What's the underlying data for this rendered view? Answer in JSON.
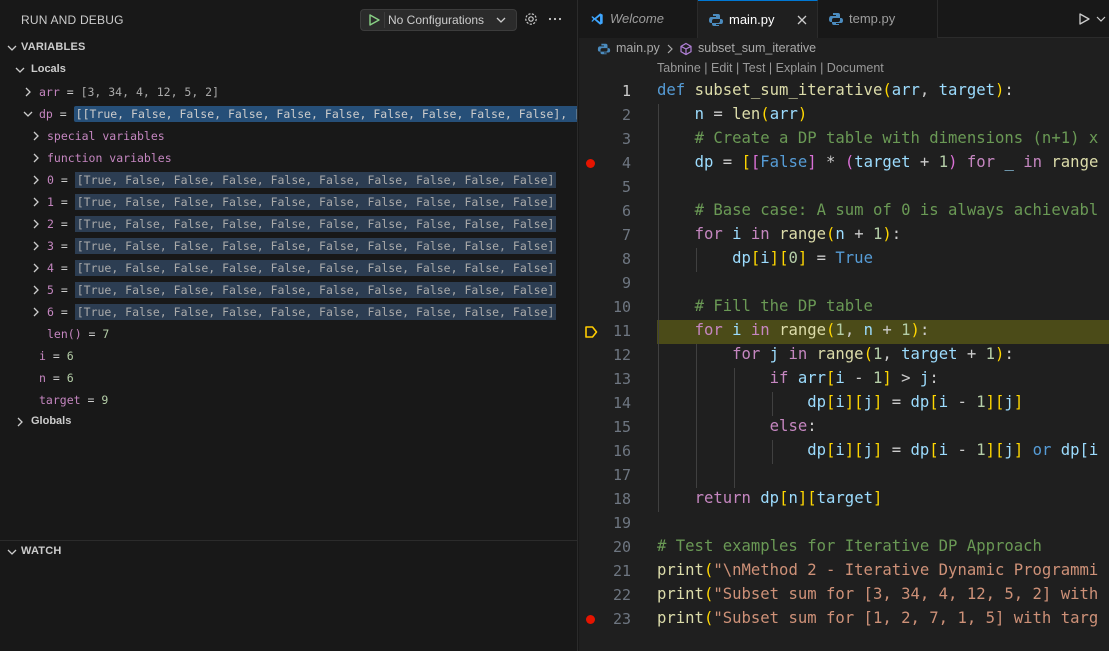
{
  "sidebar": {
    "title": "RUN AND DEBUG",
    "config_label": "No Configurations",
    "variables_header": "VARIABLES",
    "locals_label": "Locals",
    "arr": {
      "name": "arr",
      "value": "[3, 34, 4, 12, 5, 2]"
    },
    "dp": {
      "name": "dp",
      "value": "[[True, False, False, False, False, False, False, False, False, False], [Tr..."
    },
    "special_variables": "special variables",
    "function_variables": "function variables",
    "dp_rows": [
      {
        "index": "0",
        "value": "[True, False, False, False, False, False, False, False, False, False]"
      },
      {
        "index": "1",
        "value": "[True, False, False, False, False, False, False, False, False, False]"
      },
      {
        "index": "2",
        "value": "[True, False, False, False, False, False, False, False, False, False]"
      },
      {
        "index": "3",
        "value": "[True, False, False, False, False, False, False, False, False, False]"
      },
      {
        "index": "4",
        "value": "[True, False, False, False, False, False, False, False, False, False]"
      },
      {
        "index": "5",
        "value": "[True, False, False, False, False, False, False, False, False, False]"
      },
      {
        "index": "6",
        "value": "[True, False, False, False, False, False, False, False, False, False]"
      }
    ],
    "len": {
      "name": "len()",
      "value": "7"
    },
    "i": {
      "name": "i",
      "value": "6"
    },
    "n": {
      "name": "n",
      "value": "6"
    },
    "target": {
      "name": "target",
      "value": "9"
    },
    "globals_label": "Globals",
    "watch_header": "WATCH"
  },
  "tabs": [
    {
      "label": "Welcome",
      "active": false
    },
    {
      "label": "main.py",
      "active": true
    },
    {
      "label": "temp.py",
      "active": false
    }
  ],
  "breadcrumb": {
    "file": "main.py",
    "symbol": "subset_sum_iterative"
  },
  "codelens": "Tabnine | Edit | Test | Explain | Document",
  "current_line": 11,
  "breakpoints": [
    4,
    23
  ],
  "line_numbers": [
    "1",
    "2",
    "3",
    "4",
    "5",
    "6",
    "7",
    "8",
    "9",
    "10",
    "11",
    "12",
    "13",
    "14",
    "15",
    "16",
    "17",
    "18",
    "19",
    "20",
    "21",
    "22",
    "23"
  ],
  "code": {
    "l1": {
      "def": "def",
      "fn": "subset_sum_iterative",
      "p1": "arr",
      "p2": "target"
    },
    "l2": {
      "var": "n",
      "fn": "len",
      "arg": "arr"
    },
    "l3": "# Create a DP table with dimensions (n+1) x",
    "l4": {
      "var": "dp",
      "const": "False",
      "t": "target",
      "one": "1",
      "for": "for",
      "u": "_",
      "in": "in",
      "rng": "range"
    },
    "l6": "# Base case: A sum of 0 is always achievabl",
    "l7": {
      "for": "for",
      "v": "i",
      "in": "in",
      "rng": "range",
      "n": "n",
      "one": "1"
    },
    "l8": {
      "dp": "dp",
      "i": "i",
      "z": "0",
      "t": "True"
    },
    "l10": "# Fill the DP table",
    "l11": {
      "for": "for",
      "v": "i",
      "in": "in",
      "rng": "range",
      "one": "1",
      "n": "n",
      "one2": "1"
    },
    "l12": {
      "for": "for",
      "v": "j",
      "in": "in",
      "rng": "range",
      "one": "1",
      "t": "target",
      "one2": "1"
    },
    "l13": {
      "if": "if",
      "arr": "arr",
      "i": "i",
      "one": "1",
      "j": "j"
    },
    "l14": {
      "dp": "dp",
      "i": "i",
      "j": "j",
      "dp2": "dp",
      "i2": "i",
      "one": "1",
      "j2": "j"
    },
    "l15": "else",
    "l16": {
      "dp": "dp",
      "i": "i",
      "j": "j",
      "dp2": "dp",
      "i2": "i",
      "one": "1",
      "j2": "j",
      "or": "or",
      "dp3": "dp[i"
    },
    "l18": {
      "ret": "return",
      "dp": "dp",
      "n": "n",
      "t": "target"
    },
    "l20": "# Test examples for Iterative DP Approach",
    "l21": {
      "fn": "print",
      "s": "\"\\nMethod 2 - Iterative Dynamic Programmi"
    },
    "l22": {
      "fn": "print",
      "s": "\"Subset sum for [3, 34, 4, 12, 5, 2] with"
    },
    "l23": {
      "fn": "print",
      "s": "\"Subset sum for [1, 2, 7, 1, 5] with targ"
    }
  }
}
